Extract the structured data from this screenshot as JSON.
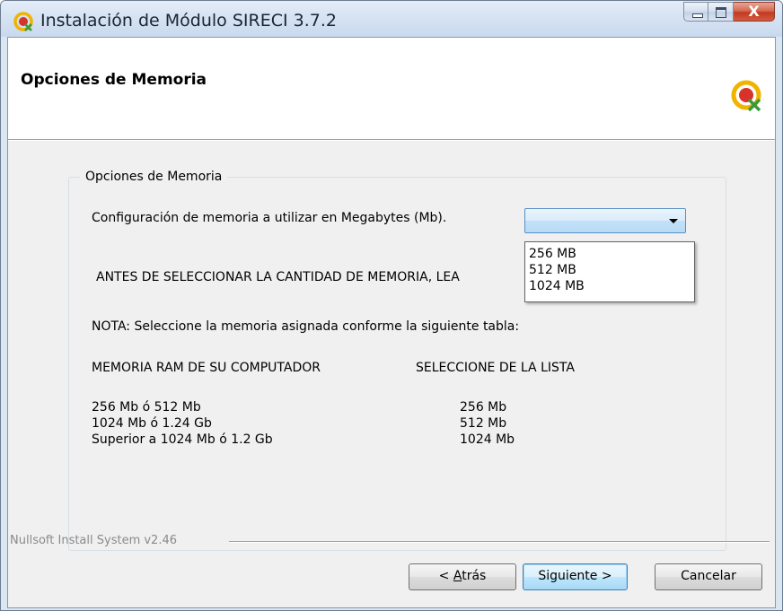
{
  "window": {
    "title": "Instalación de Módulo SIRECI 3.7.2",
    "close_glyph": "X"
  },
  "header": {
    "title": "Opciones de Memoria",
    "logo_icon": "sireci-logo-icon"
  },
  "group": {
    "legend": "Opciones de Memoria",
    "config_label": "Configuración de memoria a utilizar en Megabytes (Mb).",
    "warning": "ANTES DE SELECCIONAR LA CANTIDAD DE MEMORIA, LEA",
    "note": "NOTA: Seleccione la memoria asignada conforme la siguiente tabla:",
    "memory_combo": {
      "selected": "",
      "options": [
        "256 MB",
        "512 MB",
        "1024 MB"
      ]
    },
    "table": {
      "headers": [
        "MEMORIA RAM DE SU COMPUTADOR",
        "SELECCIONE DE LA LISTA"
      ],
      "rows": [
        [
          "256  Mb ó 512 Mb",
          "256 Mb"
        ],
        [
          "1024 Mb ó 1.24 Gb",
          "512 Mb"
        ],
        [
          "Superior a 1024 Mb ó 1.2 Gb",
          "1024 Mb"
        ]
      ]
    }
  },
  "footer": {
    "branding": "Nullsoft Install System v2.46",
    "back_prefix": "< ",
    "back_accel": "A",
    "back_rest": "trás",
    "next_label": "Siguiente >",
    "cancel_label": "Cancelar"
  },
  "colors": {
    "titlebar": "#d5e2f2",
    "close_button": "#c23a1f",
    "combo_accent": "#5690c6",
    "dialog_background": "#f0f0f0"
  }
}
